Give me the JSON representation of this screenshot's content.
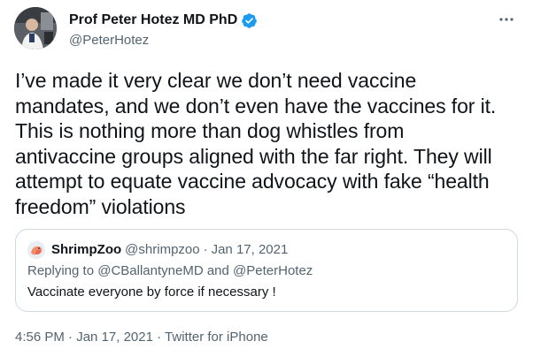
{
  "author": {
    "name": "Prof Peter Hotez MD PhD",
    "handle": "@PeterHotez",
    "verified": true
  },
  "tweet": {
    "lines": [
      "I’ve made it very clear we don’t need vaccine",
      "mandates, and we don’t even have the vaccines for it.",
      "This is nothing more than dog whistles from",
      "antivaccine groups aligned with the far right. They will",
      "attempt to equate vaccine advocacy with fake “health",
      "freedom” violations"
    ]
  },
  "quote": {
    "name": "ShrimpZoo",
    "handle": "@shrimpzoo",
    "separator": "·",
    "date": "Jan 17, 2021",
    "reply_prefix": "Replying to",
    "reply_mention_1": "@CBallantyneMD",
    "reply_and": "and",
    "reply_mention_2": "@PeterHotez",
    "text": "Vaccinate everyone by force if necessary !"
  },
  "meta": {
    "time": "4:56 PM",
    "separator": "·",
    "date": "Jan 17, 2021",
    "source": "Twitter for iPhone"
  },
  "colors": {
    "verified_badge": "#1d9bf0",
    "secondary_text": "#536471",
    "border": "#cfd9de"
  },
  "icons": {
    "more": "more-horizontal-icon",
    "verified": "verified-badge-icon"
  }
}
